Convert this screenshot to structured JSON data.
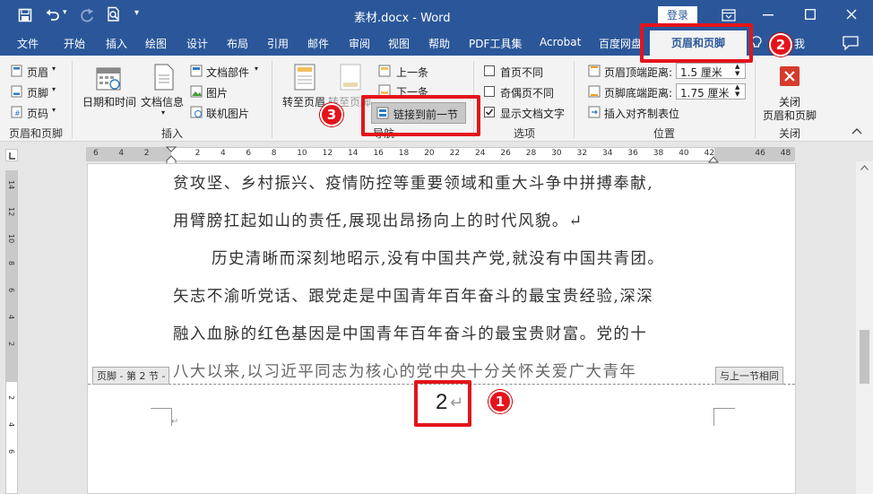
{
  "titlebar": {
    "doc_title": "素材.docx - Word",
    "login": "登录"
  },
  "tabs": [
    "文件",
    "开始",
    "插入",
    "绘图",
    "设计",
    "布局",
    "引用",
    "邮件",
    "审阅",
    "视图",
    "帮助",
    "PDF工具集",
    "Acrobat",
    "百度网盘",
    "页眉和页脚"
  ],
  "tell_me": "我",
  "ribbon": {
    "hf_group": {
      "header": "页眉",
      "footer": "页脚",
      "page_number": "页码",
      "label": "页眉和页脚"
    },
    "insert_group": {
      "datetime": "日期和时间",
      "docinfo": "文档信息",
      "quickparts": "文档部件",
      "pictures": "图片",
      "online_pictures": "联机图片",
      "label": "插入"
    },
    "nav_group": {
      "goto_header": "转至页眉",
      "goto_footer": "转至页脚",
      "prev": "上一条",
      "next": "下一条",
      "link_prev": "链接到前一节",
      "label": "导航"
    },
    "options_group": {
      "diff_first": "首页不同",
      "diff_odd_even": "奇偶页不同",
      "show_text": "显示文档文字",
      "label": "选项"
    },
    "position_group": {
      "header_top_label": "页眉顶端距离:",
      "header_top_value": "1.5 厘米",
      "footer_bottom_label": "页脚底端距离:",
      "footer_bottom_value": "1.75 厘米",
      "align_tab": "插入对齐制表位",
      "label": "位置"
    },
    "close_group": {
      "close_line1": "关闭",
      "close_line2": "页眉和页脚",
      "label": "关闭"
    }
  },
  "ruler_numbers": [
    "6",
    "4",
    "2",
    "",
    "2",
    "4",
    "6",
    "8",
    "10",
    "12",
    "14",
    "16",
    "18",
    "20",
    "22",
    "24",
    "26",
    "28",
    "30",
    "32",
    "34",
    "36",
    "38",
    "40",
    "42",
    "",
    "46",
    "48"
  ],
  "vruler_numbers": [
    "14",
    "12",
    "10",
    "8",
    "6",
    "4",
    "2",
    "",
    "2",
    "4",
    "6"
  ],
  "document": {
    "lines": [
      "贫攻坚、乡村振兴、疫情防控等重要领域和重大斗争中拼搏奉献,",
      "用臂膀扛起如山的责任,展现出昂扬向上的时代风貌。↵",
      "历史清晰而深刻地昭示,没有中国共产党,就没有中国共青团。",
      "矢志不渝听党话、跟党走是中国青年百年奋斗的最宝贵经验,深深",
      "融入血脉的红色基因是中国青年百年奋斗的最宝贵财富。党的十",
      "八大以来,以习近平同志为核心的党中央十分关怀关爱广大青年"
    ],
    "footer_tag": "页脚 - 第 2 节 -",
    "same_as_prev": "与上一节相同",
    "page_number": "2",
    "return_mark": "↵"
  },
  "annotations": {
    "b1": "1",
    "b2": "2",
    "b3": "3"
  }
}
